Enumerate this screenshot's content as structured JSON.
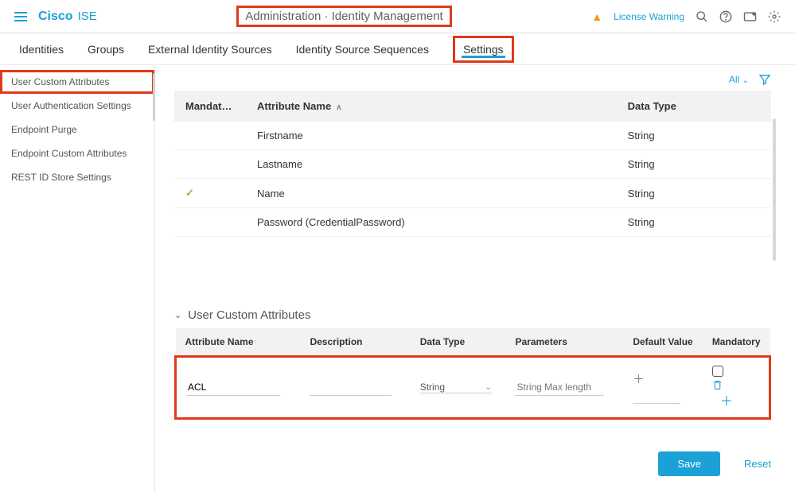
{
  "header": {
    "brand": "Cisco",
    "product": "ISE",
    "breadcrumb": "Administration · Identity Management",
    "license_warning": "License Warning"
  },
  "tabs": [
    "Identities",
    "Groups",
    "External Identity Sources",
    "Identity Source Sequences",
    "Settings"
  ],
  "active_tab_index": 4,
  "sidebar": {
    "items": [
      "User Custom Attributes",
      "User Authentication Settings",
      "Endpoint Purge",
      "Endpoint Custom Attributes",
      "REST ID Store Settings"
    ],
    "active_index": 0
  },
  "toolbar": {
    "filter_label": "All"
  },
  "predef_table": {
    "cols": {
      "mandatory": "Mandat…",
      "attr_name": "Attribute Name",
      "data_type": "Data Type"
    },
    "rows": [
      {
        "mandatory": false,
        "name": "Firstname",
        "type": "String"
      },
      {
        "mandatory": false,
        "name": "Lastname",
        "type": "String"
      },
      {
        "mandatory": true,
        "name": "Name",
        "type": "String"
      },
      {
        "mandatory": false,
        "name": "Password (CredentialPassword)",
        "type": "String"
      }
    ]
  },
  "custom_section": {
    "title": "User Custom Attributes",
    "cols": {
      "attr_name": "Attribute Name",
      "description": "Description",
      "data_type": "Data Type",
      "parameters": "Parameters",
      "default": "Default Value",
      "mandatory": "Mandatory"
    },
    "row": {
      "attr_name": "ACL",
      "description": "",
      "data_type": "String",
      "parameters_placeholder": "String Max length",
      "default": "",
      "mandatory": false
    }
  },
  "actions": {
    "save": "Save",
    "reset": "Reset"
  }
}
